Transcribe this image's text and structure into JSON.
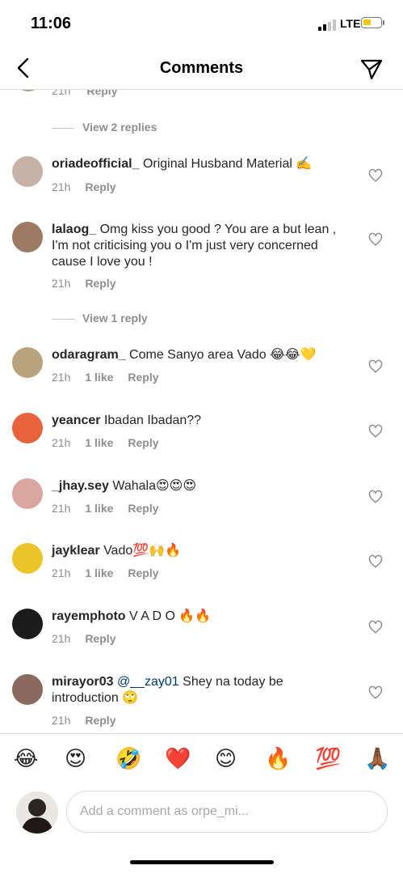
{
  "status_bar": {
    "time": "11:06",
    "network": "LTE",
    "battery_level": 0.45
  },
  "header": {
    "title": "Comments",
    "back_icon": "chevron-left-icon",
    "send_icon": "paper-plane-icon"
  },
  "partial_comment": {
    "time": "21h",
    "reply": "Reply"
  },
  "view_replies": [
    "View 2 replies",
    "View 1 reply"
  ],
  "comments": [
    {
      "user": "oriadeofficial_",
      "text": "Original Husband Material ✍️",
      "time": "21h",
      "likes": "",
      "reply": "Reply",
      "avatar_color": "#c6b2a6"
    },
    {
      "user": "lalaog_",
      "text": "Omg kiss you good ? You are a but lean , I'm not criticising you o I'm just very concerned cause I love you !",
      "time": "21h",
      "likes": "",
      "reply": "Reply",
      "avatar_color": "#9c7a64"
    },
    {
      "user": "odaragram_",
      "text": "Come Sanyo area Vado 😂😂💛",
      "time": "21h",
      "likes": "1 like",
      "reply": "Reply",
      "avatar_color": "#b9a27e"
    },
    {
      "user": "yeancer",
      "text": "Ibadan Ibadan??",
      "time": "21h",
      "likes": "1 like",
      "reply": "Reply",
      "avatar_color": "#e8623c"
    },
    {
      "user": "_jhay.sey",
      "text": "Wahala😍😍😍",
      "time": "21h",
      "likes": "1 like",
      "reply": "Reply",
      "avatar_color": "#d9a6a0"
    },
    {
      "user": "jayklear",
      "text": "Vado💯🙌🔥",
      "time": "21h",
      "likes": "1 like",
      "reply": "Reply",
      "avatar_color": "#e9c52a"
    },
    {
      "user": "rayemphoto",
      "text": "V A D O 🔥🔥",
      "time": "21h",
      "likes": "",
      "reply": "Reply",
      "avatar_color": "#1c1c1c"
    },
    {
      "user": "mirayor03",
      "mention": "@__zay01",
      "text": "Shey na today be introduction 🙄",
      "time": "21h",
      "likes": "",
      "reply": "Reply",
      "avatar_color": "#8a6a5e"
    }
  ],
  "emoji_bar": [
    "😂",
    "😍",
    "🤣",
    "❤️",
    "😊",
    "🔥",
    "💯",
    "🙏🏾"
  ],
  "composer": {
    "placeholder": "Add a comment as orpe_mi..."
  },
  "colors": {
    "text": "#262626",
    "muted": "#8e8e8e",
    "mention": "#00376b",
    "divider": "#dbdbdb"
  }
}
